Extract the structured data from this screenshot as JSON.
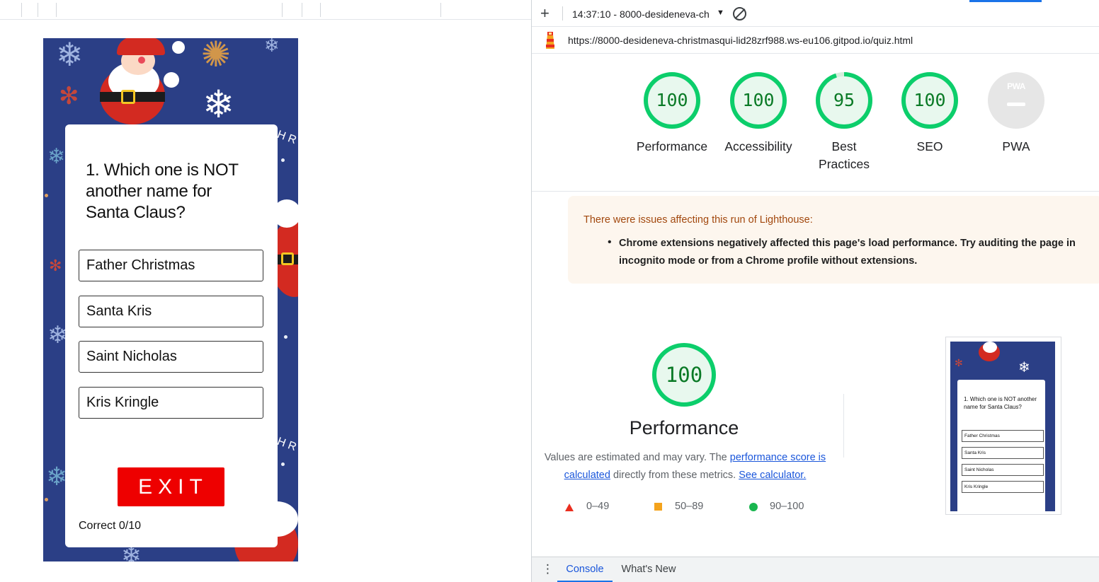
{
  "quiz": {
    "question": "1. Which one is NOT another name for Santa Claus?",
    "answers": [
      "Father Christmas",
      "Santa Kris",
      "Saint Nicholas",
      "Kris Kringle"
    ],
    "exit_label": "EXIT",
    "score": "Correct 0/10"
  },
  "devtools": {
    "report_select": "14:37:10 - 8000-desideneva-ch",
    "url": "https://8000-desideneva-christmasqui-lid28zrf988.ws-eu106.gitpod.io/quiz.html",
    "categories": [
      {
        "label": "Performance",
        "score": "100",
        "value": 1.0
      },
      {
        "label": "Accessibility",
        "score": "100",
        "value": 1.0
      },
      {
        "label": "Best\nPractices",
        "score": "95",
        "value": 0.95
      },
      {
        "label": "SEO",
        "score": "100",
        "value": 1.0
      },
      {
        "label": "PWA",
        "score": "",
        "value": null
      }
    ],
    "pwa_badge": "PWA",
    "warning": {
      "title": "There were issues affecting this run of Lighthouse:",
      "item": "Chrome extensions negatively affected this page's load performance. Try auditing the page in incognito mode or from a Chrome profile without extensions."
    },
    "performance": {
      "score": "100",
      "title": "Performance",
      "desc_prefix": "Values are estimated and may vary. The ",
      "desc_link1": "performance score is calculated",
      "desc_middle": " directly from these metrics. ",
      "desc_link2": "See calculator."
    },
    "legend": [
      {
        "shape": "triangle",
        "label": "0–49",
        "color": "#ea2e1f"
      },
      {
        "shape": "square",
        "label": "50–89",
        "color": "#f4a31c"
      },
      {
        "shape": "circle",
        "label": "90–100",
        "color": "#19b64f"
      }
    ],
    "thumbnail": {
      "question": "1. Which one is NOT another name for Santa Claus?",
      "answers": [
        "Father Christmas",
        "Santa Kris",
        "Saint Nicholas",
        "Kris Kringle"
      ]
    },
    "drawer_tabs": [
      "Console",
      "What's New"
    ]
  },
  "colors": {
    "pass_green": "#0cce6b",
    "pass_text": "#0a7a26",
    "quiz_bg": "#2b3f86",
    "exit_red": "#ee0000"
  },
  "icons": [
    "plus-icon",
    "clear-icon",
    "lighthouse-icon",
    "menu-dots-icon",
    "snowflake-icon",
    "santa-illustration"
  ]
}
